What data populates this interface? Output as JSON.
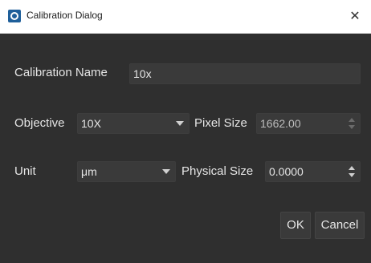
{
  "window": {
    "title": "Calibration Dialog",
    "close_symbol": "✕"
  },
  "icons": {
    "app": "app-logo-icon",
    "close": "close-icon",
    "dropdown": "chevron-down-icon",
    "spin_up": "spin-up-icon",
    "spin_down": "spin-down-icon"
  },
  "form": {
    "calibration_name": {
      "label": "Calibration Name",
      "value": "10x"
    },
    "objective": {
      "label": "Objective",
      "value": "10X"
    },
    "pixel_size": {
      "label": "Pixel Size",
      "value": "1662.00"
    },
    "unit": {
      "label": "Unit",
      "value": "μm"
    },
    "physical_size": {
      "label": "Physical Size",
      "value": "0.0000"
    }
  },
  "buttons": {
    "ok": "OK",
    "cancel": "Cancel"
  },
  "colors": {
    "background": "#2f2f2f",
    "field": "#3a3a3a",
    "text": "#e6e6e6",
    "titlebar": "#ffffff",
    "app_icon": "#1f5f9a"
  }
}
